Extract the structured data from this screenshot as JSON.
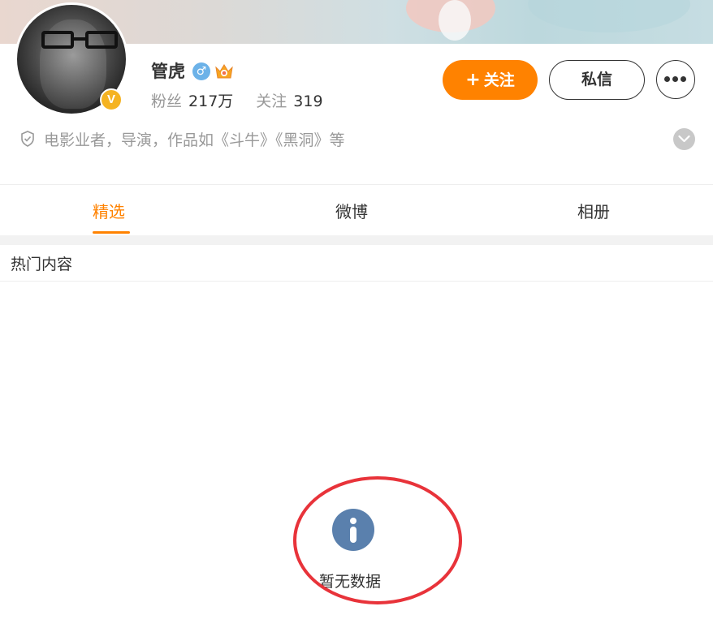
{
  "profile": {
    "name": "管虎",
    "verified_badge": "V",
    "gender_icon": "male-icon",
    "gender_symbol": "♂",
    "fans_label": "粉丝",
    "fans_count": "217万",
    "following_label": "关注",
    "following_count": "319",
    "bio": "电影业者，导演，作品如《斗牛》《黑洞》等"
  },
  "actions": {
    "follow_plus": "+",
    "follow_label": "关注",
    "message_label": "私信"
  },
  "tabs": [
    {
      "label": "精选",
      "active": true
    },
    {
      "label": "微博",
      "active": false
    },
    {
      "label": "相册",
      "active": false
    }
  ],
  "section": {
    "title": "热门内容"
  },
  "empty_state": {
    "icon": "info-icon",
    "text": "暂无数据"
  },
  "colors": {
    "accent": "#ff8200",
    "verified": "#f5b321",
    "info": "#5a80ad",
    "annotation": "#e8333a"
  }
}
